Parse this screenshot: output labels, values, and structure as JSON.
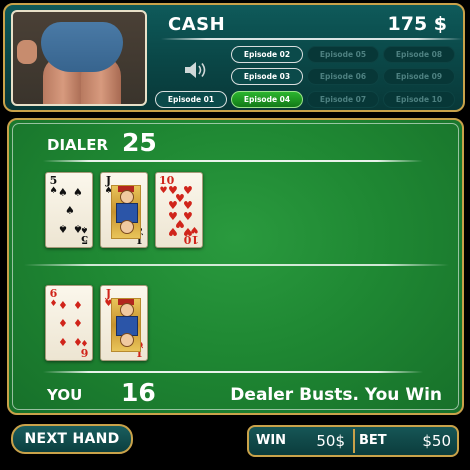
{
  "header": {
    "cash_label": "CASH",
    "cash_value": "175 $"
  },
  "episodes": [
    {
      "label": "Episode 01",
      "state": "available"
    },
    {
      "label": "Episode 02",
      "state": "available"
    },
    {
      "label": "Episode 03",
      "state": "available"
    },
    {
      "label": "Episode 04",
      "state": "current"
    },
    {
      "label": "Episode 05",
      "state": "locked"
    },
    {
      "label": "Episode 06",
      "state": "locked"
    },
    {
      "label": "Episode 07",
      "state": "locked"
    },
    {
      "label": "Episode 08",
      "state": "locked"
    },
    {
      "label": "Episode 09",
      "state": "locked"
    },
    {
      "label": "Episode 10",
      "state": "locked"
    }
  ],
  "dealer": {
    "label": "DIALER",
    "score": "25",
    "cards": [
      {
        "rank": "5",
        "suit": "♠",
        "color": "black"
      },
      {
        "rank": "J",
        "suit": "♠",
        "color": "black"
      },
      {
        "rank": "10",
        "suit": "♥",
        "color": "red"
      }
    ]
  },
  "player": {
    "label": "YOU",
    "score": "16",
    "cards": [
      {
        "rank": "6",
        "suit": "♦",
        "color": "red"
      },
      {
        "rank": "J",
        "suit": "♥",
        "color": "red"
      }
    ]
  },
  "result_text": "Dealer Busts. You Win",
  "controls": {
    "next_hand_label": "NEXT HAND",
    "win_label": "WIN",
    "win_value": "50$",
    "bet_label": "BET",
    "bet_value": "$50"
  },
  "colors": {
    "felt": "#1f8833",
    "gold_border": "#c9a24a",
    "panel_teal": "#0a4646",
    "episode_current": "#2bb52e"
  },
  "icons": {
    "sound": "speaker-icon"
  }
}
